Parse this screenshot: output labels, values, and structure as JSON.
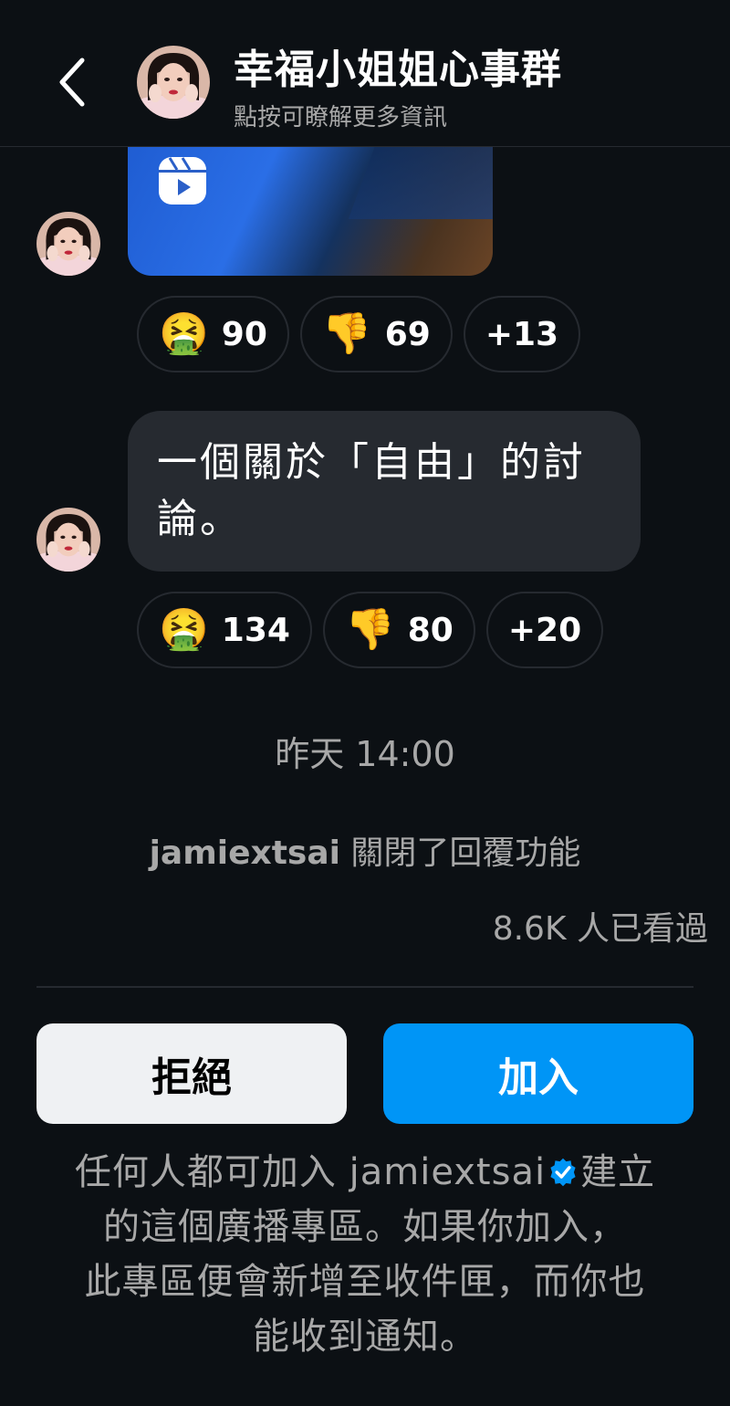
{
  "header": {
    "back_icon": "chevron-left-icon",
    "title": "幸福小姐姐心事群",
    "subtitle": "點按可瞭解更多資訊"
  },
  "messages": [
    {
      "type": "reel",
      "media_icon": "reels-icon",
      "reactions": [
        {
          "emoji": "🤮",
          "count": "90"
        },
        {
          "emoji": "👎",
          "count": "69"
        },
        {
          "label": "+13"
        }
      ]
    },
    {
      "type": "text",
      "text_line1": "一個關於「自由」的討",
      "text_line2": "論。",
      "reactions": [
        {
          "emoji": "🤮",
          "count": "134"
        },
        {
          "emoji": "👎",
          "count": "80"
        },
        {
          "label": "+20"
        }
      ]
    }
  ],
  "timestamp": "昨天 14:00",
  "system_message": {
    "username": "jamiextsai",
    "text": " 關閉了回覆功能"
  },
  "seen_count": "8.6K 人已看過",
  "actions": {
    "decline_label": "拒絕",
    "join_label": "加入"
  },
  "notice": {
    "part1": "任何人都可加入 jamiextsai",
    "part2": "建立",
    "line2": "的這個廣播專區。如果你加入，",
    "line3": "此專區便會新增至收件匣，而你也",
    "line4": "能收到通知。"
  },
  "colors": {
    "background": "#0c1014",
    "bubble": "#262a30",
    "join_button": "#0095f6",
    "decline_button": "#eff1f3",
    "verified_badge": "#0095f6"
  }
}
